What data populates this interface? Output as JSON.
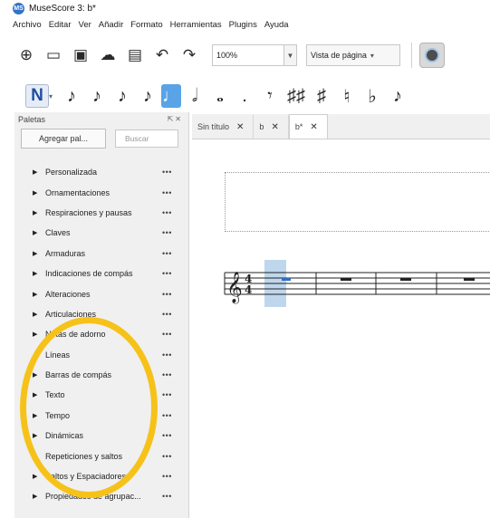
{
  "window": {
    "title": "MuseScore 3: b*",
    "logo_text": "MS"
  },
  "menu": [
    "Archivo",
    "Editar",
    "Ver",
    "Añadir",
    "Formato",
    "Herramientas",
    "Plugins",
    "Ayuda"
  ],
  "toolbar": {
    "buttons": [
      {
        "name": "new-score-icon",
        "glyph": "⊕"
      },
      {
        "name": "open-folder-icon",
        "glyph": "▭"
      },
      {
        "name": "save-icon",
        "glyph": "▣"
      },
      {
        "name": "cloud-upload-icon",
        "glyph": "☁"
      },
      {
        "name": "print-icon",
        "glyph": "▤"
      },
      {
        "name": "undo-icon",
        "glyph": "↶"
      },
      {
        "name": "redo-icon",
        "glyph": "↷"
      }
    ],
    "zoom": "100%",
    "view_mode": "Vista de página",
    "metronome_icon": "metronome-icon"
  },
  "notebar": {
    "input_glyph": "N",
    "buttons": [
      {
        "name": "duration-64th-icon",
        "glyph": "♪"
      },
      {
        "name": "duration-32nd-icon",
        "glyph": "♪"
      },
      {
        "name": "duration-16th-icon",
        "glyph": "♪"
      },
      {
        "name": "duration-eighth-icon",
        "glyph": "♪"
      },
      {
        "name": "duration-quarter-icon",
        "glyph": "♩",
        "active": true
      },
      {
        "name": "duration-half-icon",
        "glyph": "𝅗𝅥"
      },
      {
        "name": "duration-whole-icon",
        "glyph": "𝅝"
      },
      {
        "name": "augmentation-dot-icon",
        "glyph": "."
      },
      {
        "name": "rest-icon",
        "glyph": "𝄾"
      },
      {
        "name": "double-sharp-icon",
        "glyph": "♯♯"
      },
      {
        "name": "sharp-icon",
        "glyph": "♯"
      },
      {
        "name": "natural-icon",
        "glyph": "♮"
      },
      {
        "name": "flat-icon",
        "glyph": "♭"
      },
      {
        "name": "voice-icon",
        "glyph": "♪"
      }
    ]
  },
  "palettes": {
    "header": "Paletas",
    "add_button": "Agregar pal...",
    "search_placeholder": "Buscar",
    "items": [
      {
        "label": "Personalizada",
        "arrow": true
      },
      {
        "label": "Ornamentaciones",
        "arrow": true
      },
      {
        "label": "Respiraciones y pausas",
        "arrow": true
      },
      {
        "label": "Claves",
        "arrow": true
      },
      {
        "label": "Armaduras",
        "arrow": true
      },
      {
        "label": "Indicaciones de compás",
        "arrow": true
      },
      {
        "label": "Alteraciones",
        "arrow": true
      },
      {
        "label": "Articulaciones",
        "arrow": true
      },
      {
        "label": "Notas de adorno",
        "arrow": true
      },
      {
        "label": "Líneas",
        "arrow": false
      },
      {
        "label": "Barras de compás",
        "arrow": true
      },
      {
        "label": "Texto",
        "arrow": true
      },
      {
        "label": "Tempo",
        "arrow": true
      },
      {
        "label": "Dinámicas",
        "arrow": true
      },
      {
        "label": "Repeticiones y saltos",
        "arrow": true
      },
      {
        "label": "Saltos y Espaciadores",
        "arrow": true
      },
      {
        "label": "Propiedades de agrupac...",
        "arrow": true
      }
    ]
  },
  "tabs": [
    {
      "label": "Sin título",
      "close": "✕"
    },
    {
      "label": "b",
      "close": "✕"
    },
    {
      "label": "b*",
      "close": "✕",
      "active": true
    }
  ],
  "score": {
    "time_sig_top": "4",
    "time_sig_bottom": "4"
  },
  "colors": {
    "annotation_ring": "#f6c21a",
    "selection": "#a9c9e6",
    "active_note": "#5aa3e6"
  }
}
